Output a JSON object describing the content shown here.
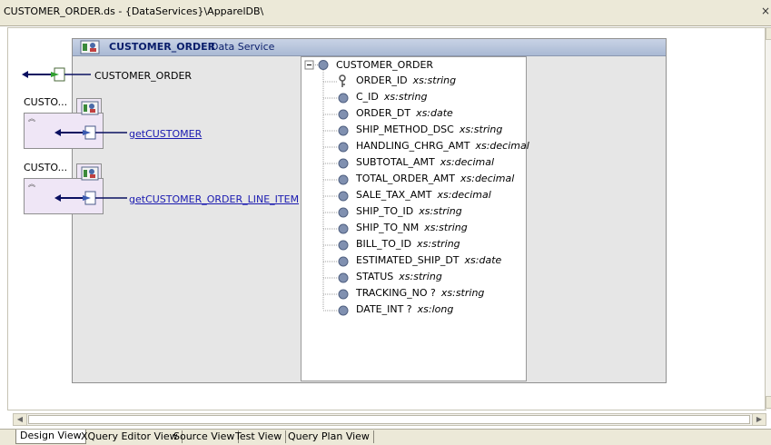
{
  "window": {
    "title": "CUSTOMER_ORDER.ds - {DataServices}\\ApparelDB\\",
    "close_label": "×"
  },
  "data_service": {
    "name": "CUSTOMER_ORDER",
    "label": "Data Service"
  },
  "left_items": {
    "source": {
      "label": "CUSTOMER_ORDER"
    },
    "functions": [
      {
        "truncated_title": "CUSTO...",
        "link": "getCUSTOMER"
      },
      {
        "truncated_title": "CUSTO...",
        "link": "getCUSTOMER_ORDER_LINE_ITEM"
      }
    ]
  },
  "schema": {
    "root": "CUSTOMER_ORDER",
    "fields": [
      {
        "name": "ORDER_ID",
        "type": "xs:string",
        "key": true
      },
      {
        "name": "C_ID",
        "type": "xs:string"
      },
      {
        "name": "ORDER_DT",
        "type": "xs:date"
      },
      {
        "name": "SHIP_METHOD_DSC",
        "type": "xs:string"
      },
      {
        "name": "HANDLING_CHRG_AMT",
        "type": "xs:decimal"
      },
      {
        "name": "SUBTOTAL_AMT",
        "type": "xs:decimal"
      },
      {
        "name": "TOTAL_ORDER_AMT",
        "type": "xs:decimal"
      },
      {
        "name": "SALE_TAX_AMT",
        "type": "xs:decimal"
      },
      {
        "name": "SHIP_TO_ID",
        "type": "xs:string"
      },
      {
        "name": "SHIP_TO_NM",
        "type": "xs:string"
      },
      {
        "name": "BILL_TO_ID",
        "type": "xs:string"
      },
      {
        "name": "ESTIMATED_SHIP_DT",
        "type": "xs:date"
      },
      {
        "name": "STATUS",
        "type": "xs:string"
      },
      {
        "name": "TRACKING_NO ?",
        "type": "xs:string"
      },
      {
        "name": "DATE_INT ?",
        "type": "xs:long"
      }
    ]
  },
  "tabs": [
    {
      "label": "Design View",
      "active": true
    },
    {
      "label": "XQuery Editor View"
    },
    {
      "label": "Source View"
    },
    {
      "label": "Test View"
    },
    {
      "label": "Query Plan View"
    }
  ],
  "colors": {
    "header_text": "#0a1e6b",
    "link": "#1a1ab0",
    "arrow": "#0a1060",
    "card_fill": "#efe6f6",
    "node_fill": "#8090b0"
  }
}
